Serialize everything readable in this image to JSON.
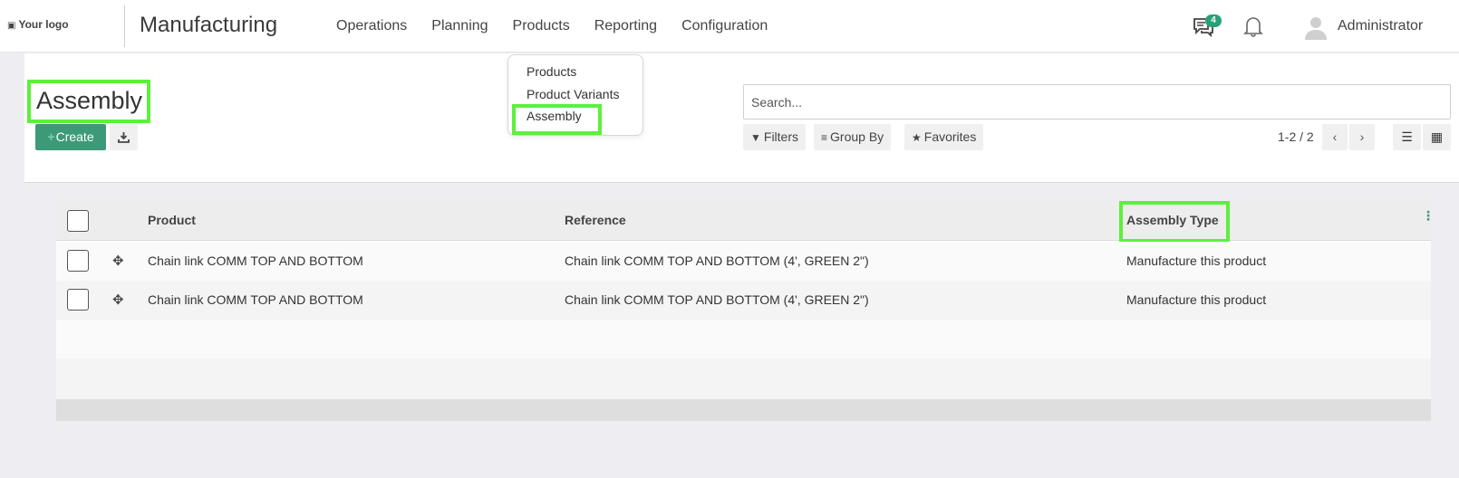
{
  "navbar": {
    "logo_text": "Your logo",
    "app_title": "Manufacturing",
    "menu": [
      "Operations",
      "Planning",
      "Products",
      "Reporting",
      "Configuration"
    ],
    "message_count": "4",
    "user_name": "Administrator"
  },
  "dropdown": {
    "items": [
      "Products",
      "Product Variants",
      "Assembly"
    ]
  },
  "control_panel": {
    "title": "Assembly",
    "create_label": "Create",
    "search_placeholder": "Search...",
    "filters_label": "Filters",
    "group_by_label": "Group By",
    "favorites_label": "Favorites",
    "pager": "1-2 / 2"
  },
  "table": {
    "columns": [
      "Product",
      "Reference",
      "Assembly Type"
    ],
    "rows": [
      {
        "product": "Chain link COMM TOP AND BOTTOM",
        "reference": "Chain link COMM TOP AND BOTTOM (4', GREEN 2\")",
        "assembly_type": "Manufacture this product"
      },
      {
        "product": "Chain link COMM TOP AND BOTTOM",
        "reference": "Chain link COMM TOP AND BOTTOM (4', GREEN 2\")",
        "assembly_type": "Manufacture this product"
      }
    ]
  },
  "colors": {
    "accent": "#3d9a78",
    "highlight": "#5cf03c",
    "badge": "#28a07a"
  }
}
